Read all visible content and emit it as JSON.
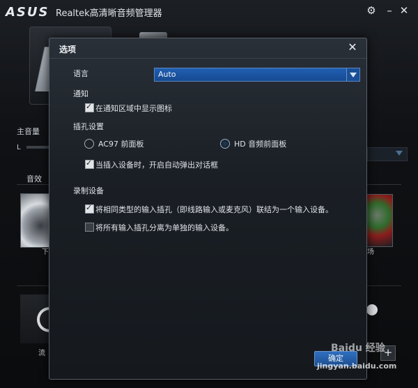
{
  "app": {
    "logo": "ASUS",
    "title": "Realtek高清晰音频管理器",
    "master_volume_label": "主音量",
    "master_l": "L",
    "effects_tab": "音效",
    "thumb_left_label": "下",
    "thumb_right_label": "场",
    "headphone_label": "流",
    "plus": "+"
  },
  "dialog": {
    "title": "选项",
    "language_label": "语言",
    "language_value": "Auto",
    "notify_label": "通知",
    "notify_checkbox": "在通知区域中显示图标",
    "jack_label": "插孔设置",
    "ac97_label": "AC97 前面板",
    "hd_label": "HD 音频前面板",
    "autopopup_checkbox": "当插入设备时，开启自动弹出对话框",
    "record_label": "录制设备",
    "merge_checkbox": "将相同类型的输入插孔（即线路输入或麦克风）联结为一个输入设备。",
    "separate_checkbox": "将所有输入插孔分离为单独的输入设备。",
    "ok_button": "确定"
  },
  "watermark": {
    "brand": "Baidu 经验",
    "url": "jingyan.baidu.com"
  }
}
